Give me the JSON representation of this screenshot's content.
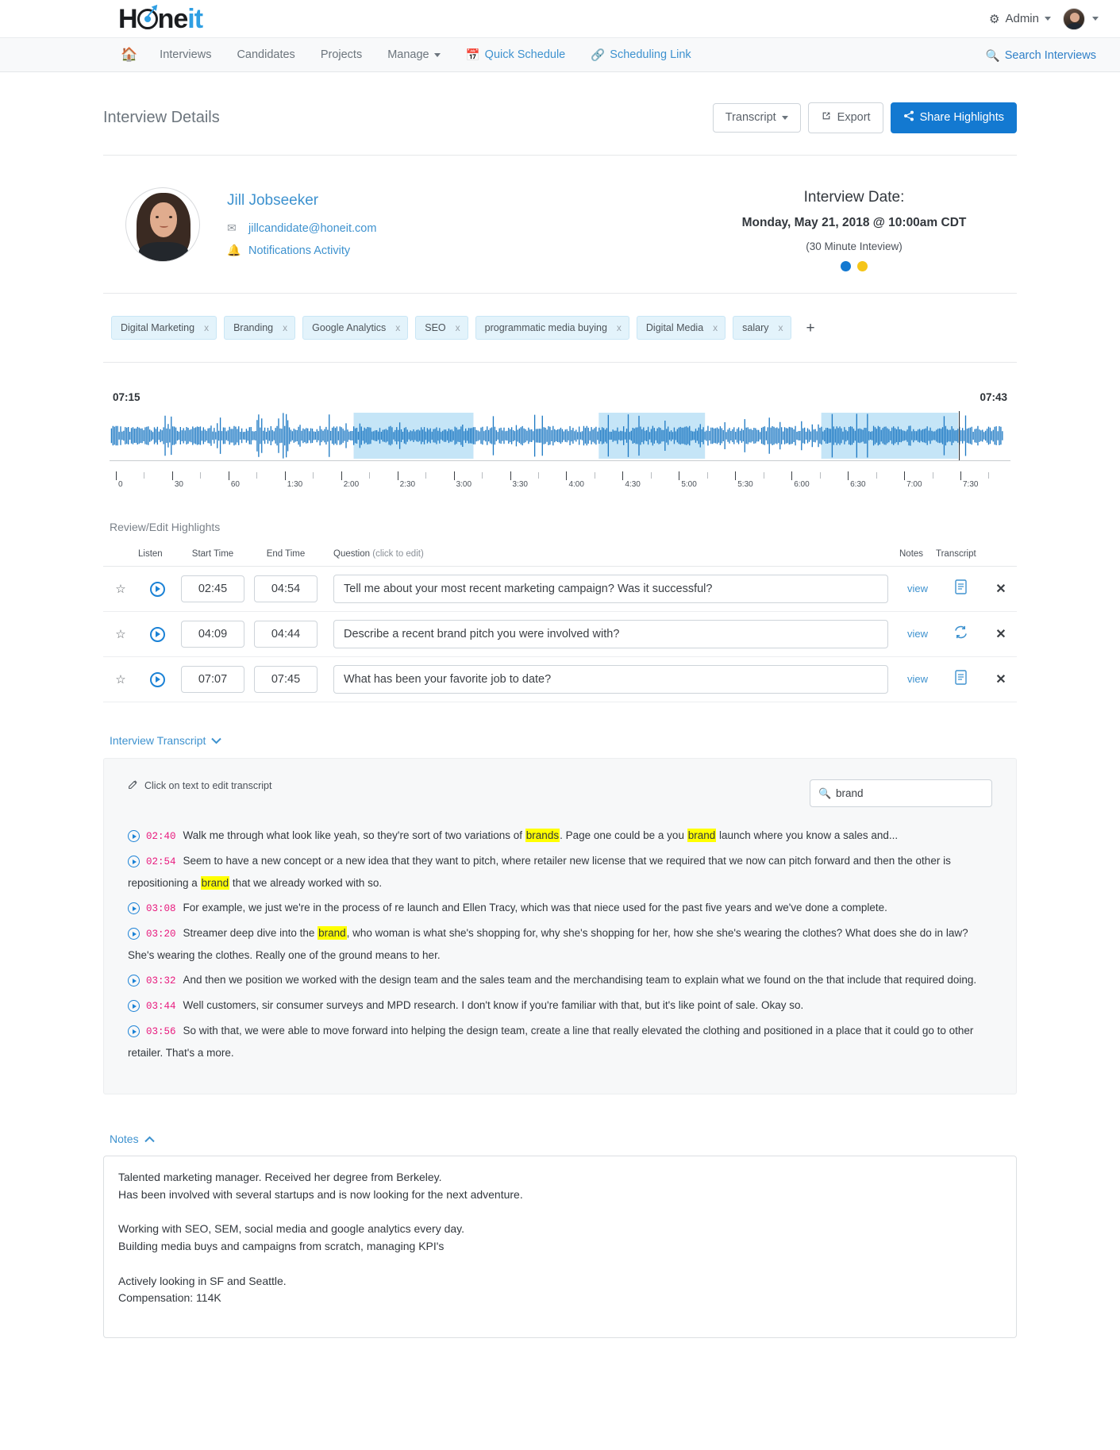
{
  "brand": {
    "name_dark": "H",
    "name_mid": "ne",
    "name_blue": "it"
  },
  "topbar": {
    "admin_label": "Admin",
    "gear_icon": "gears-icon",
    "avatar_icon": "user-avatar"
  },
  "nav": {
    "home_icon": "home-icon",
    "items": [
      {
        "label": "Interviews",
        "style": "grey"
      },
      {
        "label": "Candidates",
        "style": "grey"
      },
      {
        "label": "Projects",
        "style": "grey"
      },
      {
        "label": "Manage",
        "style": "grey",
        "caret": true
      },
      {
        "label": "Quick Schedule",
        "style": "blue",
        "icon": "calendar-icon"
      },
      {
        "label": "Scheduling Link",
        "style": "blue",
        "icon": "link-icon"
      }
    ],
    "search_label": "Search Interviews",
    "search_icon": "search-icon"
  },
  "header": {
    "title": "Interview Details",
    "transcript_button": "Transcript",
    "export_button": "Export",
    "share_button": "Share Highlights",
    "export_icon": "external-link-icon",
    "share_icon": "share-icon"
  },
  "profile": {
    "name": "Jill Jobseeker",
    "email": "jillcandidate@honeit.com",
    "notifications_label": "Notifications Activity",
    "mail_icon": "envelope-icon",
    "bell_icon": "bell-icon",
    "avatar_name": "candidate-avatar"
  },
  "interview": {
    "date_title": "Interview Date:",
    "date_main": "Monday, May 21, 2018 @ 10:00am CDT",
    "duration": "(30 Minute Inteview)",
    "dot_colors": [
      "#1379d1",
      "#f5c518"
    ]
  },
  "tags": {
    "items": [
      "Digital Marketing",
      "Branding",
      "Google Analytics",
      "SEO",
      "programmatic media buying",
      "Digital Media",
      "salary"
    ],
    "remove_label": "x",
    "add_label": "+"
  },
  "waveform": {
    "start_time": "07:15",
    "end_time": "07:43",
    "regions": [
      {
        "start_pct": 27.1,
        "width_pct": 13.3
      },
      {
        "start_pct": 54.3,
        "width_pct": 11.8
      },
      {
        "start_pct": 79.0,
        "width_pct": 15.2
      }
    ],
    "playhead_pct": 94.3,
    "ruler_labels": [
      "0",
      "30",
      "60",
      "1:30",
      "2:00",
      "2:30",
      "3:00",
      "3:30",
      "4:00",
      "4:30",
      "5:00",
      "5:30",
      "6:00",
      "6:30",
      "7:00",
      "7:30"
    ]
  },
  "highlights": {
    "section_title": "Review/Edit Highlights",
    "columns": {
      "listen": "Listen",
      "start": "Start Time",
      "end": "End Time",
      "question": "Question",
      "question_hint": "(click to edit)",
      "notes": "Notes",
      "transcript": "Transcript"
    },
    "rows": [
      {
        "start": "02:45",
        "end": "04:54",
        "question": "Tell me about your most recent marketing campaign? Was it successful?",
        "notes_label": "view",
        "transcript_icon": "document-icon"
      },
      {
        "start": "04:09",
        "end": "04:44",
        "question": "Describe a recent brand pitch you were involved with?",
        "notes_label": "view",
        "transcript_icon": "sync-icon"
      },
      {
        "start": "07:07",
        "end": "07:45",
        "question": "What has been your favorite job to date?",
        "notes_label": "view",
        "transcript_icon": "document-icon"
      }
    ]
  },
  "transcript": {
    "toggle_label": "Interview Transcript",
    "edit_hint": "Click on text to edit transcript",
    "edit_icon": "edit-icon",
    "search_value": "brand",
    "search_placeholder": "",
    "search_icon": "search-icon",
    "lines": [
      {
        "time": "02:40",
        "parts": [
          {
            "t": "Walk me through what look like yeah, so they're sort of two variations of "
          },
          {
            "t": "brands",
            "hl": true
          },
          {
            "t": ". Page one could be a you "
          },
          {
            "t": "brand",
            "hl": true
          },
          {
            "t": " launch where you know a sales and..."
          }
        ]
      },
      {
        "time": "02:54",
        "parts": [
          {
            "t": "Seem to have a new concept or a new idea that they want to pitch, where retailer new license that we required that we now can pitch forward and then the other is repositioning a "
          },
          {
            "t": "brand",
            "hl": true
          },
          {
            "t": " that we already worked with so."
          }
        ]
      },
      {
        "time": "03:08",
        "parts": [
          {
            "t": "For example, we just we're in the process of re launch and Ellen Tracy, which was that niece used for the past five years and we've done a complete."
          }
        ]
      },
      {
        "time": "03:20",
        "parts": [
          {
            "t": "Streamer deep dive into the "
          },
          {
            "t": "brand",
            "hl": true
          },
          {
            "t": ", who woman is what she's shopping for, why she's shopping for her, how she she's wearing the clothes? What does she do in law? She's wearing the clothes. Really one of the ground means to her."
          }
        ]
      },
      {
        "time": "03:32",
        "parts": [
          {
            "t": "And then we position we worked with the design team and the sales team and the merchandising team to explain what we found on the that include that required doing."
          }
        ]
      },
      {
        "time": "03:44",
        "parts": [
          {
            "t": "Well customers, sir consumer surveys and MPD research. I don't know if you're familiar with that, but it's like point of sale. Okay so."
          }
        ]
      },
      {
        "time": "03:56",
        "parts": [
          {
            "t": "So with that, we were able to move forward into helping the design team, create a line that really elevated the clothing and positioned in a place that it could go to other retailer. That's a more."
          }
        ]
      }
    ]
  },
  "notes": {
    "toggle_label": "Notes",
    "value": "Talented marketing manager. Received her degree from Berkeley.\nHas been involved with several startups and is now looking for the next adventure.\n\nWorking with SEO, SEM, social media and google analytics every day.\nBuilding media buys and campaigns from scratch, managing KPI's\n\nActively looking in SF and Seattle.\nCompensation: 114K"
  },
  "colors": {
    "brand_blue": "#2f9fe3",
    "link_blue": "#3e92cf",
    "primary_blue": "#1379d1",
    "timestamp_pink": "#e8197d",
    "highlight_yellow": "#ffff00",
    "tag_bg": "#e3f3fb"
  }
}
